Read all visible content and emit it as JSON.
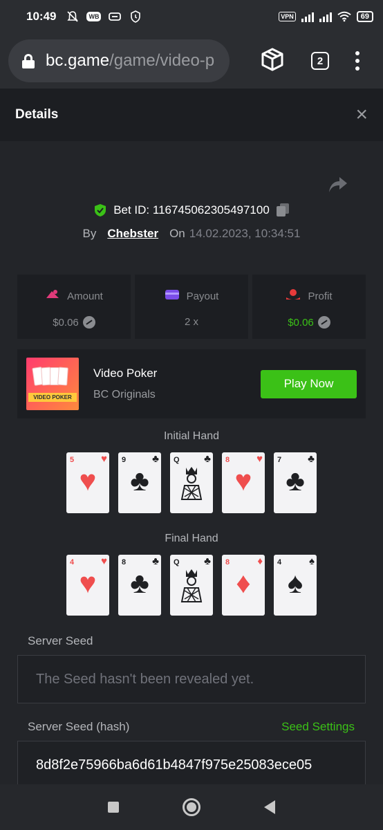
{
  "status_bar": {
    "time": "10:49",
    "vpn": "VPN",
    "battery": "69",
    "wb": "WB"
  },
  "browser": {
    "url_domain": "bc.game",
    "url_path": "/game/video-p",
    "tab_count": "2"
  },
  "header": {
    "title": "Details",
    "close": "×"
  },
  "bet": {
    "id_label": "Bet ID: 116745062305497100",
    "by_label": "By",
    "user": "Chebster",
    "on_label": "On",
    "date": "14.02.2023, 10:34:51"
  },
  "stats": {
    "amount_label": "Amount",
    "amount_value": "$0.06",
    "payout_label": "Payout",
    "payout_value": "2 x",
    "profit_label": "Profit",
    "profit_value": "$0.06",
    "amount_icon_color": "#e03a7a",
    "payout_icon_color": "#7b4de8",
    "profit_icon_color": "#e83a3a",
    "profit_color": "#3bc117"
  },
  "game": {
    "thumb_text": "VIDEO POKER",
    "title": "Video Poker",
    "subtitle": "BC Originals",
    "play_label": "Play Now"
  },
  "hands": {
    "initial_label": "Initial Hand",
    "final_label": "Final Hand",
    "initial": [
      {
        "rank": "5",
        "suit": "♥",
        "color": "red"
      },
      {
        "rank": "9",
        "suit": "♣",
        "color": "black"
      },
      {
        "rank": "Q",
        "suit": "♣",
        "color": "black"
      },
      {
        "rank": "8",
        "suit": "♥",
        "color": "red"
      },
      {
        "rank": "7",
        "suit": "♣",
        "color": "black"
      }
    ],
    "final": [
      {
        "rank": "4",
        "suit": "♥",
        "color": "red"
      },
      {
        "rank": "8",
        "suit": "♣",
        "color": "black"
      },
      {
        "rank": "Q",
        "suit": "♣",
        "color": "black"
      },
      {
        "rank": "8",
        "suit": "♦",
        "color": "red"
      },
      {
        "rank": "4",
        "suit": "♠",
        "color": "black"
      }
    ]
  },
  "seeds": {
    "server_seed_label": "Server Seed",
    "server_seed_placeholder": "The Seed hasn't been revealed yet.",
    "server_hash_label": "Server Seed (hash)",
    "seed_settings_label": "Seed Settings",
    "server_hash_value": "8d8f2e75966ba6d61b4847f975e25083ece05"
  },
  "colors": {
    "accent_green": "#3bc117",
    "panel": "#1c1e22",
    "background": "#232529"
  }
}
